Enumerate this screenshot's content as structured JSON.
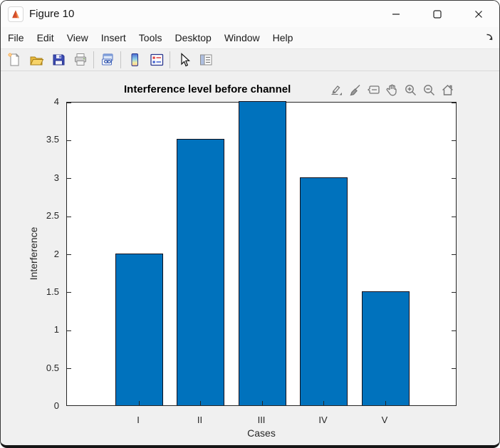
{
  "window": {
    "title": "Figure 10",
    "app_icon": "matlab-logo",
    "controls": [
      {
        "name": "minimize"
      },
      {
        "name": "maximize"
      },
      {
        "name": "close"
      }
    ]
  },
  "menu_bar": {
    "items": [
      "File",
      "Edit",
      "View",
      "Insert",
      "Tools",
      "Desktop",
      "Window",
      "Help"
    ],
    "dock_arrow_icon": "dock-figure-arrow"
  },
  "toolbar": {
    "buttons": [
      {
        "name": "new-figure",
        "icon": "new-document-icon"
      },
      {
        "name": "open-file",
        "icon": "open-folder-icon"
      },
      {
        "name": "save-figure",
        "icon": "floppy-disk-icon"
      },
      {
        "name": "print-figure",
        "icon": "printer-icon"
      },
      {
        "name": "link-plot",
        "icon": "link-plot-icon"
      },
      {
        "name": "insert-colorbar",
        "icon": "colorbar-icon"
      },
      {
        "name": "insert-legend",
        "icon": "legend-icon"
      },
      {
        "name": "edit-plot",
        "icon": "cursor-arrow-icon"
      },
      {
        "name": "property-inspector",
        "icon": "property-inspector-icon"
      }
    ]
  },
  "axes_toolbar": {
    "buttons": [
      {
        "name": "export",
        "icon": "export-pencil-icon"
      },
      {
        "name": "brush-data",
        "icon": "brush-icon"
      },
      {
        "name": "data-tips",
        "icon": "datatip-icon"
      },
      {
        "name": "pan",
        "icon": "pan-hand-icon"
      },
      {
        "name": "zoom-in",
        "icon": "zoom-in-icon"
      },
      {
        "name": "zoom-out",
        "icon": "zoom-out-icon"
      },
      {
        "name": "restore-view",
        "icon": "home-icon"
      }
    ]
  },
  "chart_data": {
    "type": "bar",
    "title": "Interference level before channel",
    "categories": [
      "I",
      "II",
      "III",
      "IV",
      "V"
    ],
    "values": [
      2,
      3.5,
      4,
      3,
      1.5
    ],
    "xlabel": "Cases",
    "ylabel": "Interference",
    "ylim": [
      0,
      4
    ],
    "ytick_step": 0.5,
    "ytick_labels": [
      "0",
      "0.5",
      "1",
      "1.5",
      "2",
      "2.5",
      "3",
      "3.5",
      "4"
    ],
    "grid": false,
    "legend": null,
    "bar_color": "#0072BD",
    "bar_edge_color": "#10101c",
    "axis_color": "#262626",
    "plot_bg": "#ffffff"
  },
  "colors": {
    "canvas_bg": "#f0f0f0",
    "titlebar_bg": "#fcfcfc",
    "menubar_bg": "#f9f9f9",
    "toolbar_bg": "#f0f0f0",
    "window_border": "#3a3a3a",
    "accent_blue": "#0072BD"
  }
}
